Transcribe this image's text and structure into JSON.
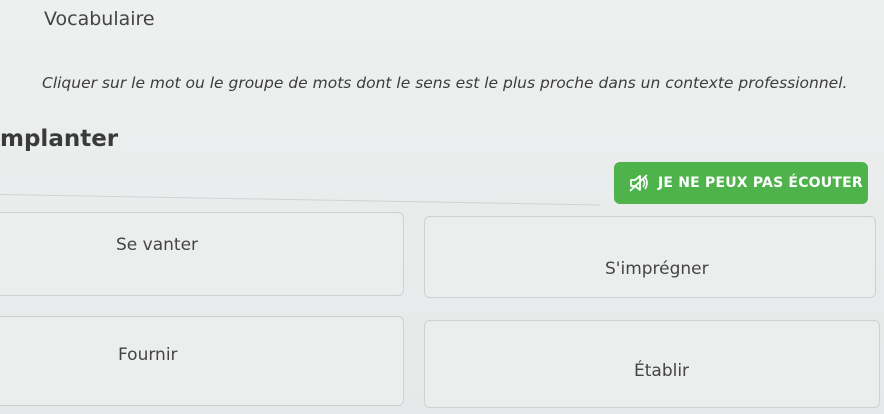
{
  "section": {
    "title": "Vocabulaire"
  },
  "instruction": "Cliquer sur le mot ou le groupe de mots dont le sens est le plus proche dans un contexte professionnel.",
  "word": "mplanter",
  "listen_button": {
    "label": "JE NE PEUX PAS ÉCOUTER",
    "icon": "speaker-muted-icon",
    "color": "#4db34a"
  },
  "choices": [
    {
      "label": "Se vanter"
    },
    {
      "label": "S'imprégner"
    },
    {
      "label": "Fournir"
    },
    {
      "label": "Établir"
    }
  ]
}
